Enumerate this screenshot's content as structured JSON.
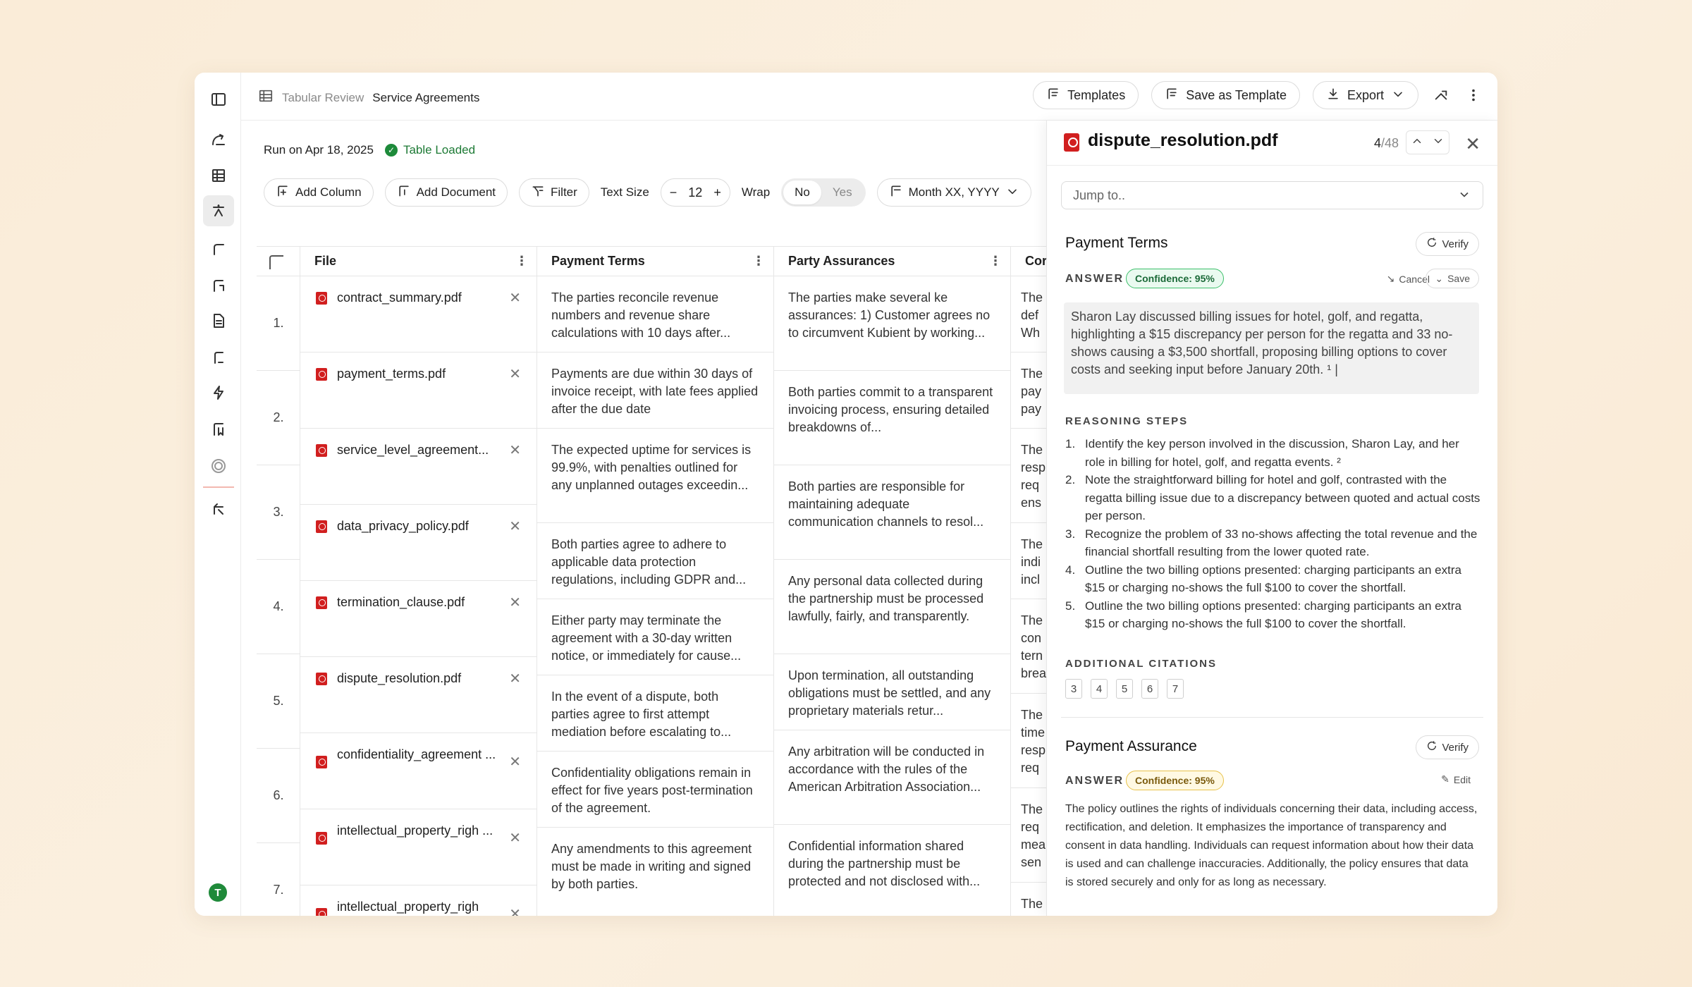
{
  "breadcrumb": {
    "section": "Tabular Review",
    "page": "Service Agreements"
  },
  "top_actions": {
    "templates": "Templates",
    "save_template": "Save as Template",
    "export": "Export"
  },
  "run": {
    "date": "Run on Apr 18, 2025",
    "status": "Table Loaded"
  },
  "toolbar": {
    "add_column": "Add Column",
    "add_document": "Add Document",
    "filter": "Filter",
    "text_size_label": "Text Size",
    "text_size_value": "12",
    "wrap_label": "Wrap",
    "wrap_no": "No",
    "wrap_yes": "Yes",
    "date_format": "Month XX, YYYY"
  },
  "table": {
    "headers": {
      "file": "File",
      "payment_terms": "Payment Terms",
      "party_assurances": "Party Assurances",
      "next": "Cor"
    },
    "row_numbers": [
      "1.",
      "2.",
      "3.",
      "4.",
      "5.",
      "6.",
      "7."
    ],
    "files": [
      "contract_summary.pdf",
      "payment_terms.pdf",
      "service_level_agreement...",
      "data_privacy_policy.pdf",
      "termination_clause.pdf",
      "dispute_resolution.pdf",
      "confidentiality_agreement ...",
      "intellectual_property_righ ...",
      "intellectual_property_righ"
    ],
    "payment_terms": [
      "The parties reconcile revenue numbers and revenue share calculations with 10 days after...",
      "Payments are due within 30 days of invoice receipt, with late fees applied after the due date",
      "The expected uptime for services is 99.9%, with penalties outlined for any unplanned outages exceedin...",
      "Both parties agree to adhere to applicable data protection regulations, including GDPR and...",
      "Either party may terminate the agreement with a 30-day written notice, or immediately for cause...",
      "In the event of a dispute, both parties agree to first attempt mediation before escalating to...",
      "Confidentiality obligations remain in effect for five years post-termination of the agreement.",
      "Any amendments to this agreement must be made in writing and signed by both parties."
    ],
    "party_assurances": [
      "The parties make several ke assurances: 1) Customer agrees no to circumvent Kubient by working...",
      "Both parties commit to a transparent invoicing process, ensuring detailed breakdowns of...",
      "Both parties are responsible for maintaining adequate communication channels to resol...",
      "Any personal data collected during the partnership must be processed lawfully, fairly, and transparently.",
      "Upon termination, all outstanding obligations must be settled, and any proprietary materials retur...",
      "Any arbitration will be conducted in accordance with the rules of the American Arbitration Association...",
      "Confidential information shared during the partnership must be protected and not disclosed with..."
    ],
    "next_col": [
      "The def Wh",
      "The pay pay",
      "The resp req ens",
      "The indi incl",
      "The con tern brea",
      "The time resp req",
      "The req mea sen",
      "The"
    ]
  },
  "panel": {
    "file": "dispute_resolution.pdf",
    "page_current": "4",
    "page_total": "/48",
    "jump_placeholder": "Jump to..",
    "section1": {
      "title": "Payment Terms",
      "verify": "Verify",
      "answer_label": "ANSWER",
      "confidence": "Confidence: 95%",
      "cancel": "Cancel",
      "save": "Save",
      "answer": "Sharon Lay discussed billing issues for hotel, golf, and regatta, highlighting a $15 discrepancy per person for the regatta and 33 no-shows causing a $3,500 shortfall, proposing billing options to cover costs and seeking input before January 20th. ¹ |",
      "reasoning_label": "REASONING STEPS",
      "steps": [
        "Identify the key person involved in the discussion, Sharon Lay, and her role in billing for hotel, golf, and regatta events. ²",
        "Note the straightforward billing for hotel and golf, contrasted with the regatta billing issue due to a discrepancy between quoted and actual costs per person.",
        "Recognize the problem of 33 no-shows affecting the total revenue and the financial shortfall resulting from the lower quoted rate.",
        "Outline the two billing options presented: charging participants an extra $15 or charging no-shows the full $100 to cover the shortfall.",
        "Outline the two billing options presented: charging participants an extra $15 or charging no-shows the full $100 to cover the shortfall."
      ],
      "step_numbers": [
        "1.",
        "2.",
        "3.",
        "4.",
        "5."
      ],
      "citations_label": "ADDITIONAL CITATIONS",
      "citations": [
        "3",
        "4",
        "5",
        "6",
        "7"
      ]
    },
    "section2": {
      "title": "Payment Assurance",
      "verify": "Verify",
      "answer_label": "ANSWER",
      "confidence": "Confidence: 95%",
      "edit": "Edit",
      "answer": "The policy outlines the rights of individuals concerning their data, including access, rectification, and deletion. It emphasizes the importance of transparency and consent in data handling. Individuals can request information about how their data is used and can challenge inaccuracies. Additionally, the policy ensures that data is stored securely and only for as long as necessary."
    }
  },
  "user": {
    "avatar_initial": "T"
  },
  "colors": {
    "accent_green": "#1d8a3a",
    "pdf_red": "#d11f1f",
    "confidence_green": "#3cbf6a",
    "confidence_yellow": "#e8c24a"
  }
}
